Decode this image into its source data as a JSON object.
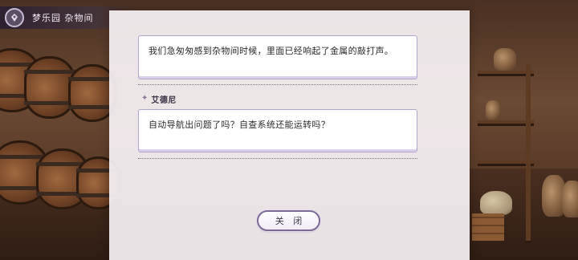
{
  "location": {
    "label": "梦乐园 杂物间",
    "icon": "location-marker-icon"
  },
  "dialog": {
    "lines": [
      {
        "speaker": "",
        "text": "我们急匆匆感到杂物间时候，里面已经响起了金属的敲打声。"
      },
      {
        "speaker": "艾德尼",
        "text": "自动导航出问题了吗？自查系统还能运转吗？"
      }
    ],
    "close_label": "关 闭"
  },
  "colors": {
    "panel": "#f7f2f5",
    "box_border": "#b3a4cc",
    "button_border": "#7b6a93"
  }
}
